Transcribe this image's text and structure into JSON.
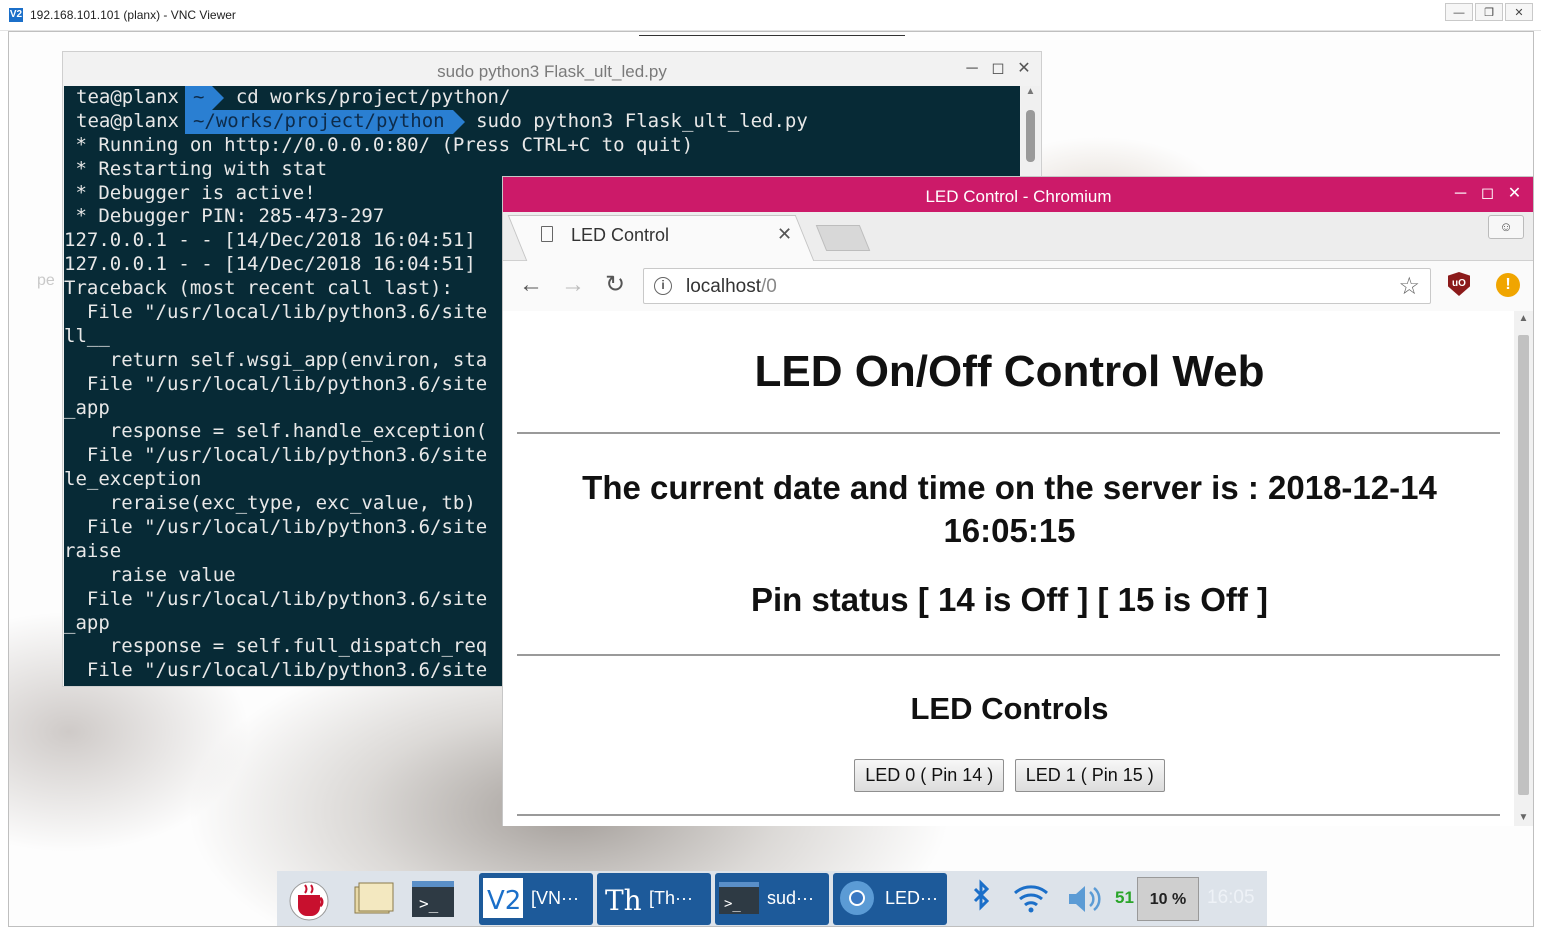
{
  "vnc": {
    "title": "192.168.101.101 (planx) - VNC Viewer",
    "logo": "V2"
  },
  "desktop": {
    "faint_text": "pe"
  },
  "terminal": {
    "title": "sudo python3 Flask_ult_led.py",
    "prompt1": {
      "user": "tea@planx",
      "dir": "~",
      "cmd": "cd works/project/python/"
    },
    "prompt2": {
      "user": "tea@planx",
      "dir": "~/works/project/python",
      "cmd": "sudo python3 Flask_ult_led.py"
    },
    "lines": [
      " * Running on http://0.0.0.0:80/ (Press CTRL+C to quit)",
      " * Restarting with stat",
      " * Debugger is active!",
      " * Debugger PIN: 285-473-297",
      "127.0.0.1 - - [14/Dec/2018 16:04:51]",
      "127.0.0.1 - - [14/Dec/2018 16:04:51]",
      "Traceback (most recent call last):",
      "  File \"/usr/local/lib/python3.6/site",
      "ll__",
      "    return self.wsgi_app(environ, sta",
      "  File \"/usr/local/lib/python3.6/site",
      "_app",
      "    response = self.handle_exception(",
      "  File \"/usr/local/lib/python3.6/site",
      "le_exception",
      "    reraise(exc_type, exc_value, tb)",
      "  File \"/usr/local/lib/python3.6/site",
      "raise",
      "    raise value",
      "  File \"/usr/local/lib/python3.6/site",
      "_app",
      "    response = self.full_dispatch_req",
      "  File \"/usr/local/lib/python3.6/site"
    ]
  },
  "chromium": {
    "window_title": "LED Control - Chromium",
    "tab_label": "LED Control",
    "url_host": "localhost",
    "url_path": "/0",
    "page": {
      "heading": "LED On/Off Control Web",
      "datetime": "The current date and time on the server is : 2018-12-14 16:05:15",
      "pin_status": "Pin status [ 14 is Off ] [ 15 is Off ]",
      "controls_heading": "LED Controls",
      "buttons": [
        "LED 0 ( Pin 14 )",
        "LED 1 ( Pin 15 )"
      ]
    }
  },
  "taskbar": {
    "tasks": [
      {
        "label": "[VN···",
        "icon": "vnc-icon"
      },
      {
        "label": "[Th···",
        "icon": "thonny-icon"
      },
      {
        "label": "sud···",
        "icon": "terminal-icon"
      },
      {
        "label": "LED···",
        "icon": "chromium-icon"
      }
    ],
    "volume_level": "51",
    "cpu": "10 %",
    "clock": "16:05"
  },
  "colors": {
    "chromium_titlebar": "#cc1a69",
    "terminal_bg": "#072a36",
    "prompt_dir_bg": "#2a7fd2",
    "task_active": "#1d5a9a"
  }
}
